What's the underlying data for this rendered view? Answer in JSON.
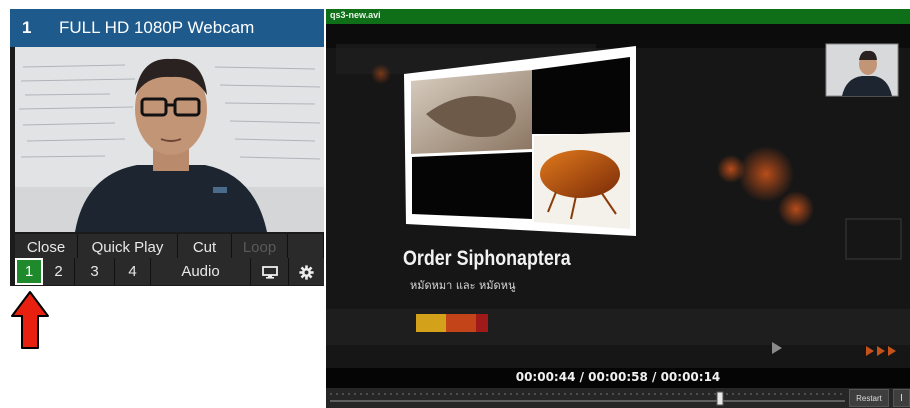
{
  "input": {
    "number": "1",
    "title": "FULL HD 1080P Webcam",
    "buttons": {
      "close": "Close",
      "quick_play": "Quick Play",
      "cut": "Cut",
      "loop": "Loop",
      "audio": "Audio"
    },
    "overlay_channels": [
      "1",
      "2",
      "3",
      "4"
    ],
    "active_channel": "1",
    "icons": [
      "monitor-icon",
      "gear-icon"
    ]
  },
  "output": {
    "filename": "qs3-new.avi",
    "slide_title": "Order Siphonaptera",
    "slide_subtitle": "หมัดหมา และ หมัดหนู",
    "time_display": "00:00:44 / 00:00:58 / 00:00:14",
    "position_fraction": 0.76,
    "restart_label": "Restart",
    "next_label": "I"
  },
  "colors": {
    "header_blue": "#1e5a8c",
    "active_green": "#1f8a2c",
    "output_title_green": "#0f6e18",
    "arrow_red": "#e8200f"
  }
}
